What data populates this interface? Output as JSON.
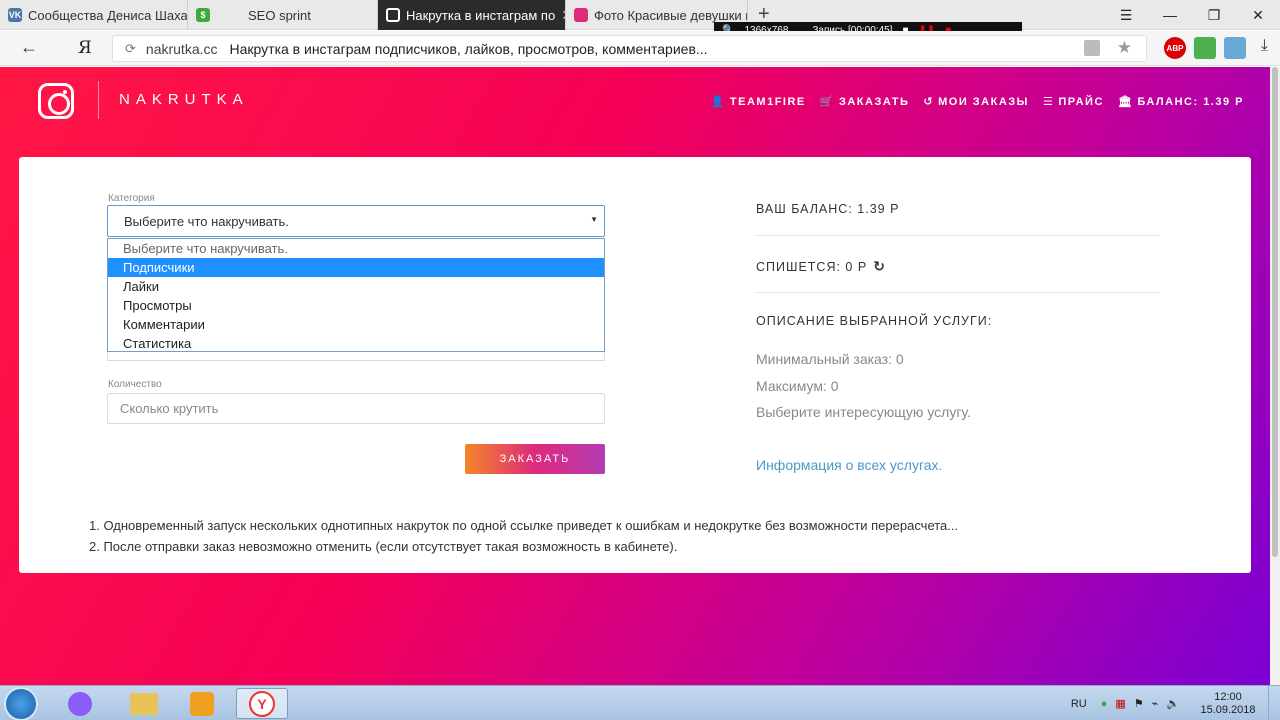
{
  "browser": {
    "tabs": [
      {
        "title": "Сообщества Дениса Шаха",
        "icon": "vk-icon",
        "color": "#4a76a8"
      },
      {
        "title": "SEO sprint",
        "icon": "seosprint-icon",
        "color": "#3caa3c"
      },
      {
        "title": "Накрутка в инстаграм по",
        "icon": "instagram-icon",
        "color": "#ffffff"
      },
      {
        "title": "Фото Красивые девушки в",
        "icon": "instagram-icon",
        "color": "#dd2a7b"
      }
    ],
    "new_tab": "+",
    "recorder": {
      "resolution": "1366x768",
      "status": "Запись [00:00:45]"
    },
    "address": {
      "yandex": "Я",
      "domain": "nakrutka.cc",
      "title": "Накрутка в инстаграм подписчиков, лайков, просмотров, комментариев..."
    },
    "extensions": [
      {
        "label": "ABP",
        "color": "#d00"
      },
      {
        "label": "",
        "color": "#4caf50"
      },
      {
        "label": "",
        "color": "#6aa9d6"
      }
    ]
  },
  "site": {
    "brand": "NAKRUTKA",
    "nav": [
      {
        "icon": "user-icon",
        "glyph": "👤",
        "label": "TEAM1FIRE"
      },
      {
        "icon": "cart-icon",
        "glyph": "🛒",
        "label": "ЗАКАЗАТЬ"
      },
      {
        "icon": "history-icon",
        "glyph": "↺",
        "label": "МОИ ЗАКАЗЫ"
      },
      {
        "icon": "list-icon",
        "glyph": "☰",
        "label": "ПРАЙС"
      },
      {
        "icon": "bank-icon",
        "glyph": "🏛",
        "label": "БАЛАНС: 1.39 Р"
      }
    ],
    "form": {
      "category_label": "Категория",
      "category_value": "Выберите что накручивать.",
      "options": [
        "Выберите что накручивать.",
        "Подписчики",
        "Лайки",
        "Просмотры",
        "Комментарии",
        "Статистика"
      ],
      "selected_index": 1,
      "quantity_label": "Количество",
      "quantity_placeholder": "Сколько крутить",
      "order_button": "ЗАКАЗАТЬ"
    },
    "sidebar": {
      "balance": "ВАШ БАЛАНС: 1.39 Р",
      "charge": "СПИШЕТСЯ: 0 Р",
      "description_title": "ОПИСАНИЕ ВЫБРАННОЙ УСЛУГИ:",
      "min_order": "Минимальный заказ: 0",
      "max_order": "Максимум: 0",
      "choose_service": "Выберите интересующую услугу.",
      "info_link": "Информация о всех услугах."
    },
    "notes": [
      "1. Одновременный запуск нескольких однотипных накруток по одной ссылке приведет к ошибкам и недокрутке без возможности перерасчета...",
      "2. После отправки заказ невозможно отменить (если отсутствует такая возможность в кабинете)."
    ]
  },
  "taskbar": {
    "lang": "RU",
    "time": "12:00",
    "date": "15.09.2018"
  }
}
